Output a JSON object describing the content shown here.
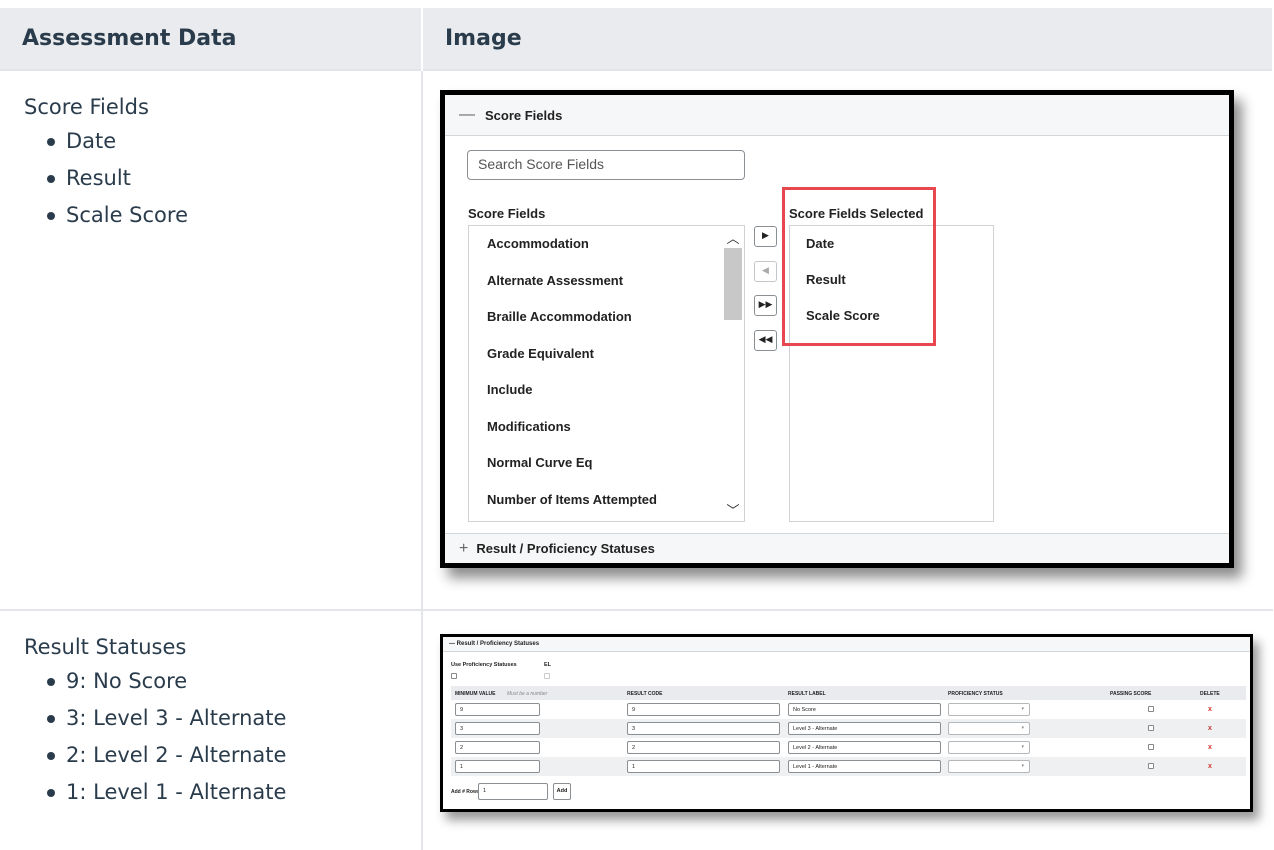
{
  "table": {
    "headers": [
      "Assessment Data",
      "Image"
    ],
    "rows": [
      {
        "title": "Score Fields",
        "items": [
          "Date",
          "Result",
          "Scale Score"
        ]
      },
      {
        "title": "Result Statuses",
        "items": [
          "9: No Score",
          "3: Level 3 - Alternate",
          "2: Level 2 - Alternate",
          "1: Level 1 - Alternate"
        ]
      }
    ]
  },
  "score_fields_panel": {
    "header": "Score Fields",
    "search_placeholder": "Search Score Fields",
    "available_label": "Score Fields",
    "selected_label": "Score Fields Selected",
    "available_items": [
      "Accommodation",
      "Alternate Assessment",
      "Braille Accommodation",
      "Grade Equivalent",
      "Include",
      "Modifications",
      "Normal Curve Eq",
      "Number of Items Attempted"
    ],
    "selected_items": [
      "Date",
      "Result",
      "Scale Score"
    ],
    "footer": "Result / Proficiency Statuses",
    "buttons": {
      "move_right": "▶",
      "move_left": "◀",
      "move_all_right": "▶▶",
      "move_all_left": "◀◀"
    },
    "highlight_color": "#e8474f"
  },
  "statuses_panel": {
    "header": "Result / Proficiency Statuses",
    "use_proficiency_label": "Use Proficiency Statuses",
    "el_label": "EL",
    "columns": {
      "minimum_value": "MINIMUM VALUE",
      "minimum_value_hint": "Must be a number",
      "result_code": "RESULT CODE",
      "result_label": "RESULT LABEL",
      "proficiency_status": "PROFICIENCY STATUS",
      "passing_score": "PASSING SCORE",
      "delete": "DELETE"
    },
    "rows": [
      {
        "min": "9",
        "code": "9",
        "label": "No Score"
      },
      {
        "min": "3",
        "code": "3",
        "label": "Level 3 - Alternate"
      },
      {
        "min": "2",
        "code": "2",
        "label": "Level 2 - Alternate"
      },
      {
        "min": "1",
        "code": "1",
        "label": "Level 1 - Alternate"
      }
    ],
    "delete_symbol": "x",
    "add_rows_label": "Add # Rows",
    "add_rows_value": "1",
    "add_button": "Add"
  }
}
